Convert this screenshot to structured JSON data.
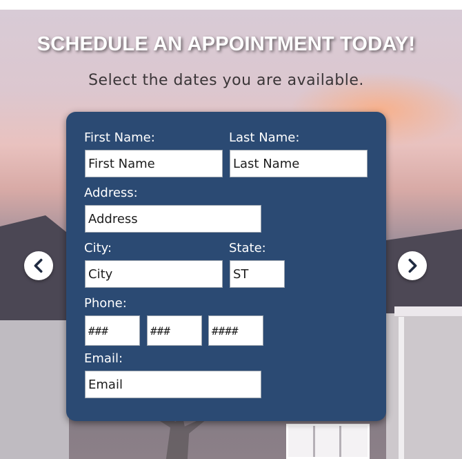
{
  "headline": "SCHEDULE AN APPOINTMENT TODAY!",
  "subheadline": "Select the dates you are available.",
  "colors": {
    "card": "#2b4a73",
    "label_text": "#ffffff",
    "headline_text": "#ffffff"
  },
  "icons": {
    "prev": "chevron-left-icon",
    "next": "chevron-right-icon"
  },
  "form": {
    "first_name": {
      "label": "First Name:",
      "placeholder": "First Name"
    },
    "last_name": {
      "label": "Last Name:",
      "placeholder": "Last Name"
    },
    "address": {
      "label": "Address:",
      "placeholder": "Address"
    },
    "city": {
      "label": "City:",
      "placeholder": "City"
    },
    "state": {
      "label": "State:",
      "placeholder": "ST"
    },
    "phone": {
      "label": "Phone:",
      "area_placeholder": "###",
      "prefix_placeholder": "###",
      "line_placeholder": "####"
    },
    "email": {
      "label": "Email:",
      "placeholder": "Email"
    }
  }
}
